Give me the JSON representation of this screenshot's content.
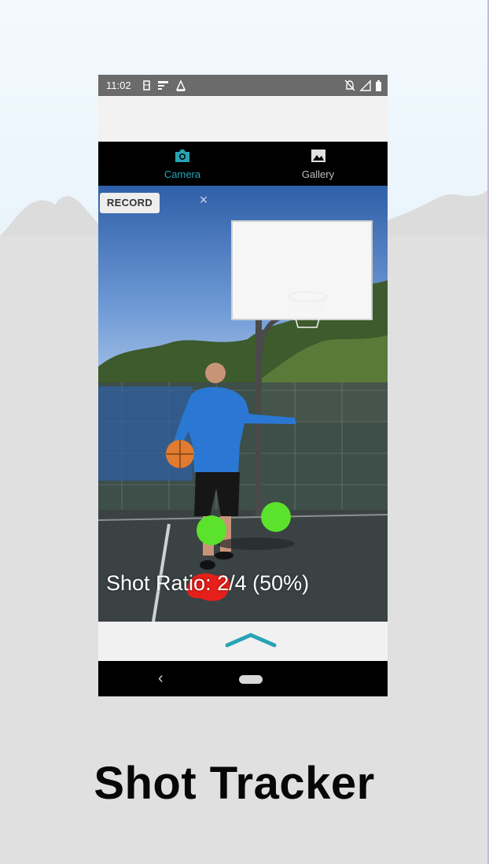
{
  "status_bar": {
    "time": "11:02",
    "left_icons": [
      "storage-icon",
      "data-saver-icon",
      "alert-icon"
    ],
    "right_icons": [
      "notifications-off-icon",
      "signal-icon",
      "battery-icon"
    ]
  },
  "tabs": [
    {
      "label": "Camera",
      "icon": "camera-icon",
      "active": true
    },
    {
      "label": "Gallery",
      "icon": "image-icon",
      "active": false
    }
  ],
  "camera_view": {
    "record_label": "RECORD",
    "close_glyph": "×",
    "shot_ratio": "Shot Ratio: 2/4 (50%)"
  },
  "bottom_sheet": {
    "icon": "chevron-up-icon"
  },
  "nav_bar": {
    "back_glyph": "‹",
    "home": "home-pill"
  },
  "title": "Shot Tracker",
  "colors": {
    "accent": "#26a4b5",
    "made_marker": "#5be22c",
    "missed_marker": "#e5201a",
    "background_top": "#f0f9ff",
    "background_bottom": "#e0e0e0"
  }
}
